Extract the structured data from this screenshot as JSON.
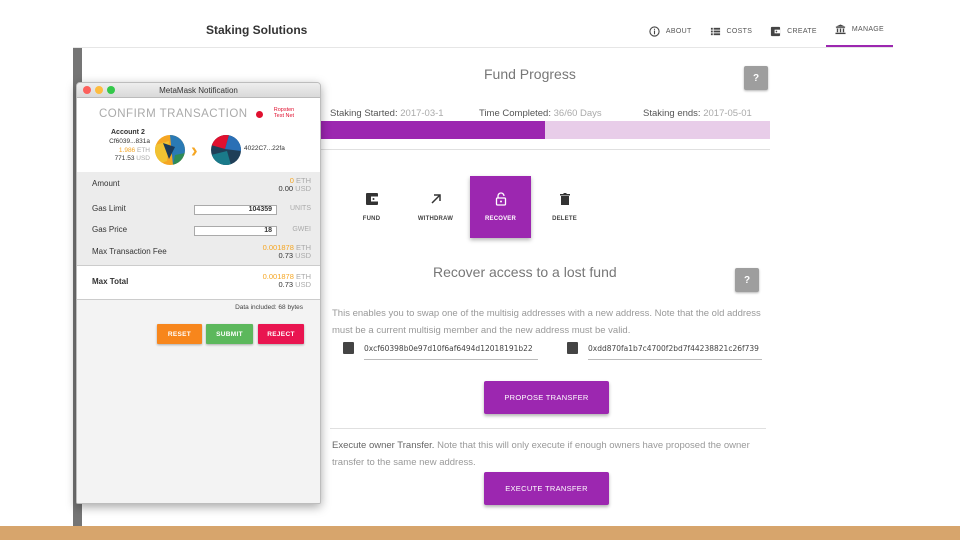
{
  "app": {
    "brand": "Staking Solutions",
    "nav": [
      {
        "label": "ABOUT",
        "icon": "info-icon"
      },
      {
        "label": "COSTS",
        "icon": "list-icon"
      },
      {
        "label": "CREATE",
        "icon": "wallet-icon"
      },
      {
        "label": "MANAGE",
        "icon": "bank-icon"
      }
    ],
    "active_nav": "MANAGE",
    "accent_color": "#9c27b0"
  },
  "fund_progress": {
    "title": "Fund Progress",
    "help_label": "?",
    "staking_started_label": "Staking Started:",
    "staking_started_value": "2017-03-1",
    "time_completed_label": "Time Completed:",
    "time_completed_value": "36/60 Days",
    "staking_ends_label": "Staking ends:",
    "staking_ends_value": "2017-05-01",
    "progress_fraction": 0.5
  },
  "actions": [
    {
      "label": "FUND",
      "icon": "wallet-icon"
    },
    {
      "label": "WITHDRAW",
      "icon": "arrow-up-right-icon"
    },
    {
      "label": "RECOVER",
      "icon": "unlock-icon",
      "active": true
    },
    {
      "label": "DELETE",
      "icon": "trash-icon"
    }
  ],
  "recover": {
    "title": "Recover access to a lost fund",
    "help_label": "?",
    "description": "This enables you to swap one of the multisig addresses with a new address. Note that the old address must be a current multisig member and the new address must be valid.",
    "old_address": "0xcf60398b0e97d10f6af6494d12018191b22",
    "new_address": "0xdd870fa1b7c4700f2bd7f44238821c26f739",
    "propose_button": "PROPOSE TRANSFER",
    "execute_lead": "Execute owner Transfer.",
    "execute_text": "Note that this will only execute if enough owners have proposed the owner transfer to the same new address.",
    "execute_button": "EXECUTE TRANSFER"
  },
  "metamask": {
    "window_title": "MetaMask Notification",
    "heading": "CONFIRM TRANSACTION",
    "network": "Ropsten Test Net",
    "account_name": "Account 2",
    "account_address": "Cf6039...831a",
    "account_eth_value": "1.986",
    "account_eth_unit": "ETH",
    "account_usd_value": "771.53",
    "account_usd_unit": "USD",
    "to_address": "4022C7...22fa",
    "amount_label": "Amount",
    "amount_eth": "0",
    "amount_eth_unit": "ETH",
    "amount_usd": "0.00",
    "amount_usd_unit": "USD",
    "gas_limit_label": "Gas Limit",
    "gas_limit_value": "104359",
    "gas_limit_unit": "UNITS",
    "gas_price_label": "Gas Price",
    "gas_price_value": "18",
    "gas_price_unit": "GWEI",
    "max_fee_label": "Max Transaction Fee",
    "max_fee_eth": "0.001878",
    "max_fee_eth_unit": "ETH",
    "max_fee_usd": "0.73",
    "max_fee_usd_unit": "USD",
    "max_total_label": "Max Total",
    "max_total_eth": "0.001878",
    "max_total_eth_unit": "ETH",
    "max_total_usd": "0.73",
    "max_total_usd_unit": "USD",
    "data_included": "Data included: 68 bytes",
    "reset_button": "RESET",
    "submit_button": "SUBMIT",
    "reject_button": "REJECT"
  }
}
